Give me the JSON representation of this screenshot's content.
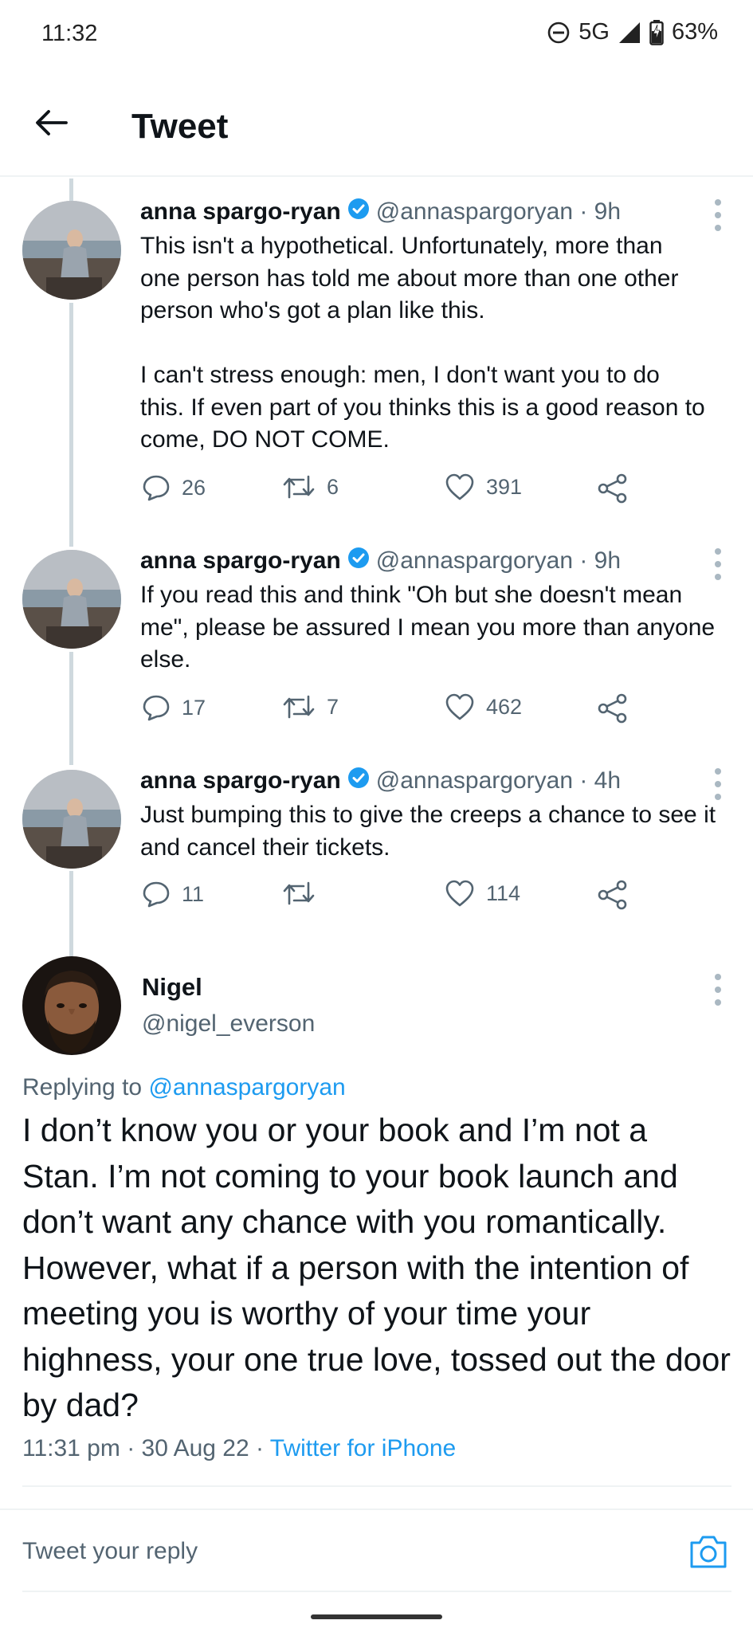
{
  "status_bar": {
    "time": "11:32",
    "network": "5G",
    "battery": "63%"
  },
  "header": {
    "title": "Tweet",
    "back_icon": "arrow-left-icon"
  },
  "thread": [
    {
      "name": "anna spargo-ryan",
      "handle": "@annaspargoryan · 9h",
      "text": "This isn't a hypothetical. Unfortunately, more than\none person has told me about more than one other\nperson who's got a plan like this.\n\nI can't stress enough: men, I don't want you to do\nthis. If even part of you thinks this is a good reason to\ncome, DO NOT COME.",
      "replies": "26",
      "retweets": "6",
      "likes": "391"
    },
    {
      "name": "anna spargo-ryan",
      "handle": "@annaspargoryan · 9h",
      "text": "If you read this and think \"Oh but she doesn't mean\nme\", please be assured I mean you more than anyone\nelse.",
      "replies": "17",
      "retweets": "7",
      "likes": "462"
    },
    {
      "name": "anna spargo-ryan",
      "handle": "@annaspargoryan · 4h",
      "text": "Just bumping this to give the creeps a chance to see it\nand cancel their tickets.",
      "replies": "11",
      "retweets": "",
      "likes": "114"
    }
  ],
  "main_tweet": {
    "name": "Nigel",
    "handle": "@nigel_everson",
    "replying_prefix": "Replying to",
    "replying_to": "@annaspargoryan",
    "text": "I don’t know you or your book and I’m not a Stan. I’m not coming to your book launch and don’t want any chance with you romantically. However, what if a person with the intention of meeting you is worthy of your time your highness, your one true love, tossed out the door by dad?",
    "timestamp": "11:31 pm · 30 Aug 22 · ",
    "source": "Twitter for iPhone"
  },
  "reply_bar": {
    "placeholder": "Tweet your reply",
    "camera_icon": "camera-icon"
  },
  "colors": {
    "accent": "#1d9bf0",
    "secondary_text": "#536471",
    "primary_text": "#0f1419",
    "thread_line": "#cfd9de"
  }
}
